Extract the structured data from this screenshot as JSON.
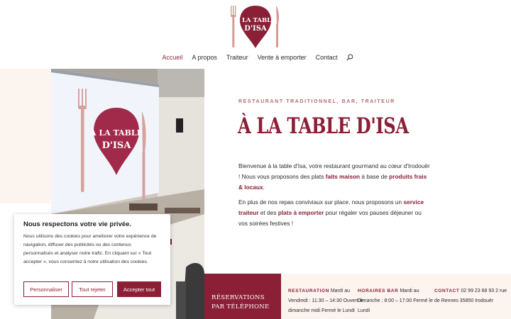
{
  "brand": {
    "logo_line1": "À LA TABLE",
    "logo_line2": "D'ISA",
    "colors": {
      "primary": "#8b1f35",
      "accent": "#b26b6f",
      "cream": "#fcf4ee"
    }
  },
  "nav": {
    "items": [
      "Accueil",
      "A propos",
      "Traiteur",
      "Vente à emporter",
      "Contact"
    ],
    "active": "Accueil",
    "search_icon": "search-icon"
  },
  "hero": {
    "tagline": "RESTAURANT TRADITIONNEL, BAR, TRAITEUR",
    "title": "À LA TABLE D'ISA",
    "p1_a": "Bienvenue à la table d'Isa, votre restaurant gourmand au cœur d'Irodouër ! Nous vous proposons des plats ",
    "p1_b": "faits maison",
    "p1_c": " à base de ",
    "p1_d": "produits frais & locaux",
    "p1_e": ".",
    "p2_a": "En plus de nos repas conviviaux sur place, nous proposons un ",
    "p2_b": "service traiteur",
    "p2_c": " et des ",
    "p2_d": "plats à emporter",
    "p2_e": " pour régaler vos pauses déjeuner ou vos soirées festives !",
    "photo_sign_line1": "À LA TABLE",
    "photo_sign_line2": "D'ISA"
  },
  "bottom": {
    "reservations": "RÉSERVATIONS PAR TÉLÉPHONE",
    "restauration_label": "RESTAURATION",
    "restauration_text": " Mardi au Vendredi : 11:30 – 14:30 Ouvert le dimanche midi Fermé le Lundi",
    "bar_label": "HORAIRES BAR",
    "bar_text": " Mardi au Dimanche : 8:00 – 17:00 Fermé le Lundi",
    "contact_label": "CONTACT",
    "contact_text": " 02 99 23 68 93 2 rue de Rennes 35850 Irodouër"
  },
  "cookie": {
    "title": "Nous respectons votre vie privée.",
    "text": "Nous utilisons des cookies pour améliorer votre expérience de navigation, diffuser des publicités ou des contenus personnalisés et analyser notre trafic. En cliquant sur « Tout accepter », vous consentez à notre utilisation des cookies.",
    "customize": "Personnaliser",
    "reject": "Tout rejeter",
    "accept": "Accepter tout"
  }
}
